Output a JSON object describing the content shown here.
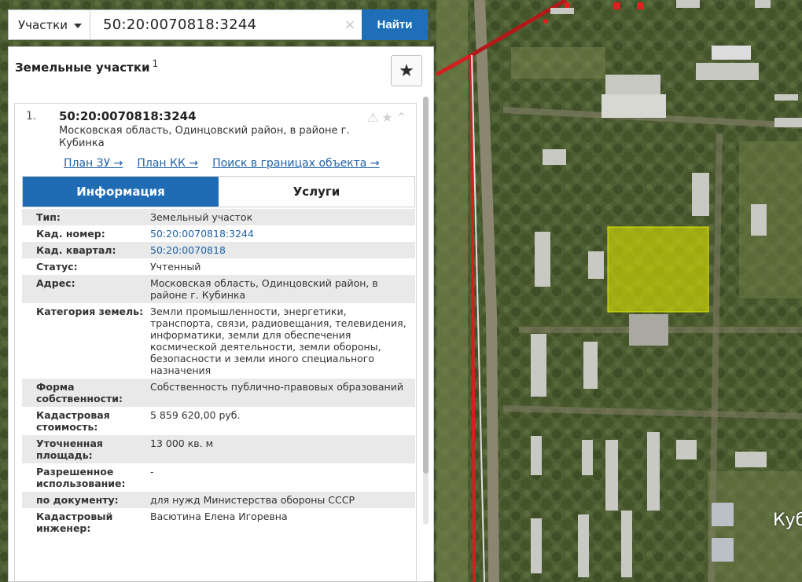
{
  "search": {
    "scope_label": "Участки",
    "query": "50:20:0070818:3244",
    "clear_glyph": "×",
    "find_label": "Найти"
  },
  "panel": {
    "title": "Земельные участки",
    "count_sup": "1",
    "favorite_icon": "star-icon"
  },
  "result": {
    "number": "1.",
    "cadastral_number": "50:20:0070818:3244",
    "address": "Московская область, Одинцовский район, в районе г. Кубинка",
    "links": [
      "План ЗУ →",
      "План КК →",
      "Поиск в границах объекта →"
    ],
    "tabs": [
      "Информация",
      "Услуги"
    ],
    "properties": [
      {
        "key": "Тип:",
        "value": "Земельный участок"
      },
      {
        "key": "Кад. номер:",
        "value": "50:20:0070818:3244"
      },
      {
        "key": "Кад. квартал:",
        "value": "50:20:0070818"
      },
      {
        "key": "Статус:",
        "value": "Учтенный"
      },
      {
        "key": "Адрес:",
        "value": "Московская область, Одинцовский район, в районе г. Кубинка"
      },
      {
        "key": "Категория земель:",
        "value": "Земли промышленности, энергетики, транспорта, связи, радиовещания, телевидения, информатики, земли для обеспечения космической деятельности, земли обороны, безопасности и земли иного специального назначения"
      },
      {
        "key": "Форма собственности:",
        "value": "Собственность публично-правовых образований"
      },
      {
        "key": "Кадастровая стоимость:",
        "value": "5 859 620,00 руб."
      },
      {
        "key": "Уточненная площадь:",
        "value": "13 000 кв. м"
      },
      {
        "key": "Разрешенное использование:",
        "value": "-"
      },
      {
        "key": "по документу:",
        "value": "для нужд Министерства обороны СССР"
      },
      {
        "key": "Кадастровый инженер:",
        "value": "Васютина Елена Игоревна"
      }
    ]
  },
  "map": {
    "label": "Куб",
    "highlight_color": "#d9e000"
  }
}
